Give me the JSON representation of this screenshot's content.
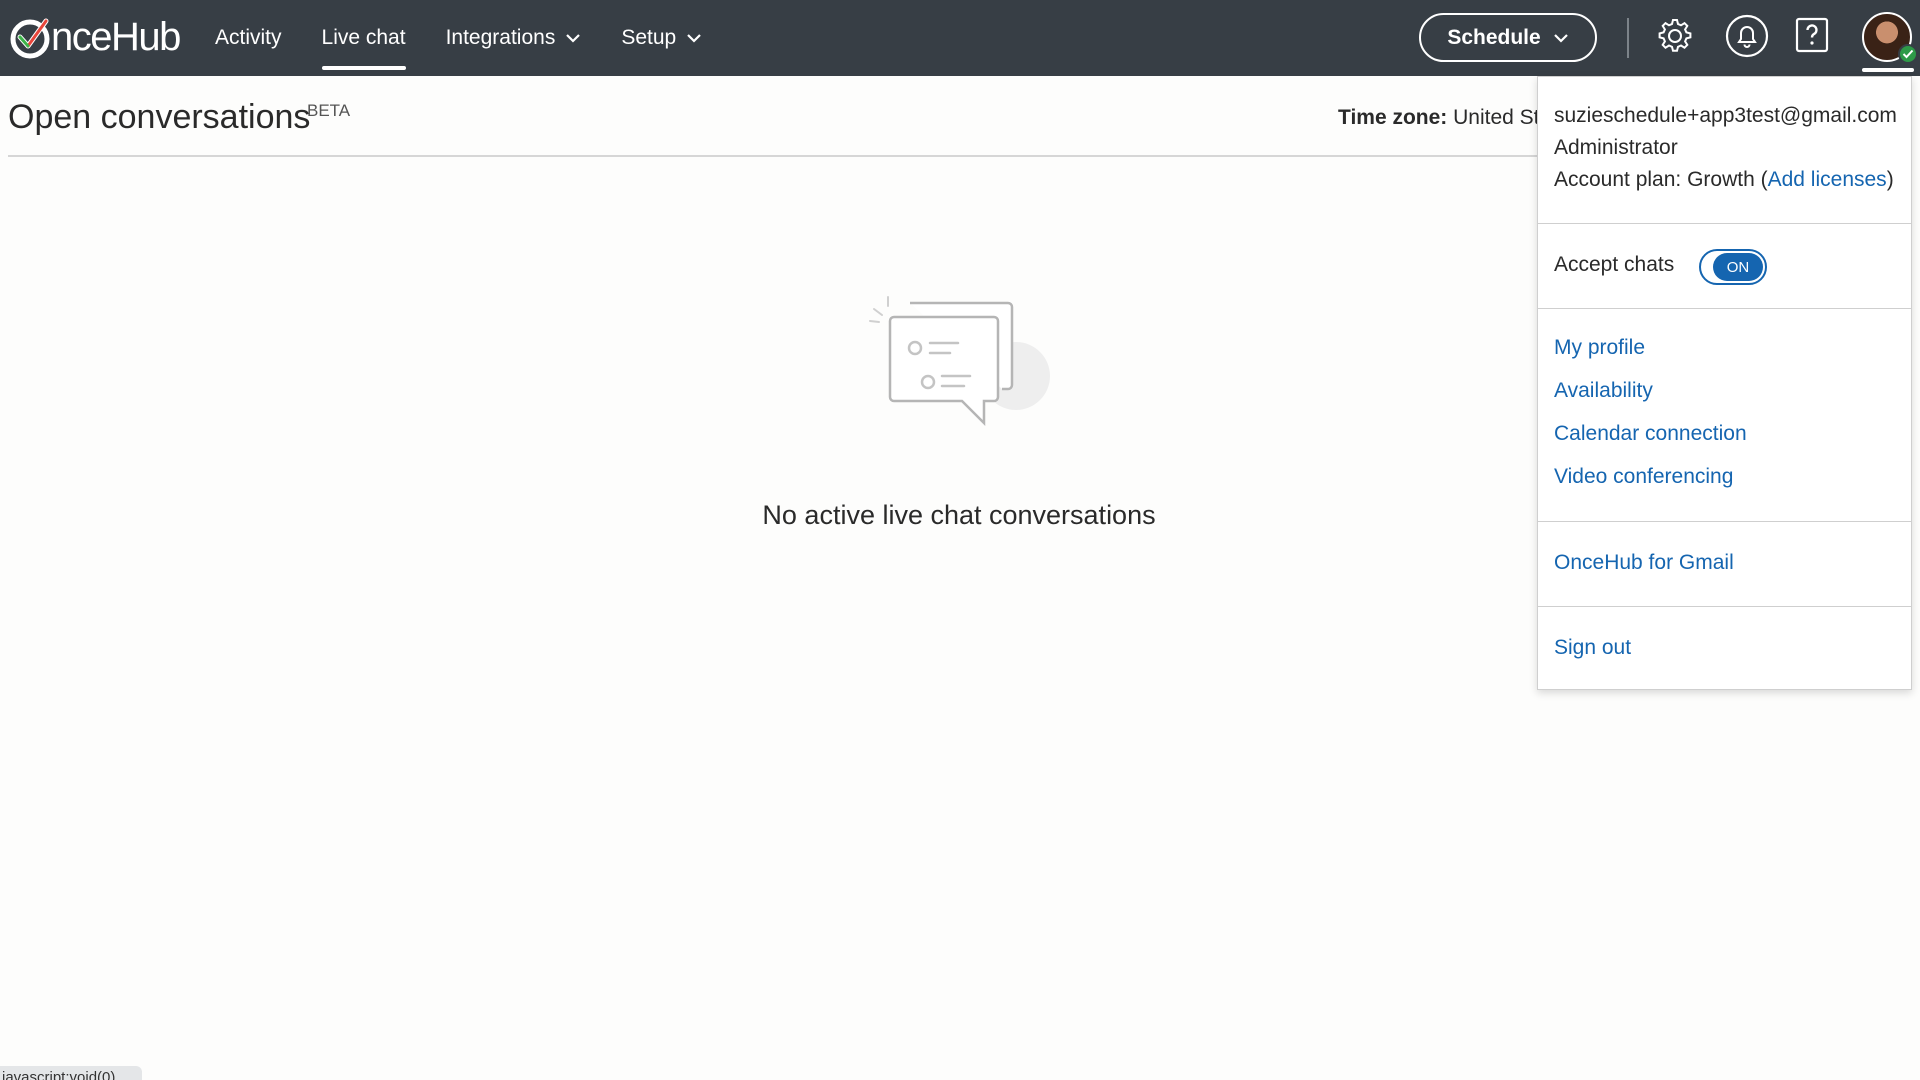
{
  "brand": {
    "logo_text": "nceHub",
    "accent": "#1565b0",
    "topbar_bg": "#373e45"
  },
  "nav": {
    "items": [
      {
        "label": "Activity",
        "active": false,
        "dropdown": false
      },
      {
        "label": "Live chat",
        "active": true,
        "dropdown": false
      },
      {
        "label": "Integrations",
        "active": false,
        "dropdown": true
      },
      {
        "label": "Setup",
        "active": false,
        "dropdown": true
      }
    ]
  },
  "toolbar": {
    "schedule_label": "Schedule",
    "icons": [
      "gear-icon",
      "bell-icon",
      "help-icon",
      "avatar"
    ]
  },
  "page": {
    "title": "Open conversations",
    "badge": "BETA",
    "timezone_label": "Time zone:",
    "timezone_value": "United St"
  },
  "empty_state": {
    "message": "No active live chat conversations",
    "icon": "chat-bubbles-illustration"
  },
  "account_menu": {
    "email": "suzieschedule+app3test@gmail.com",
    "role": "Administrator",
    "plan_prefix": "Account plan: Growth (",
    "plan_link": "Add licenses",
    "plan_suffix": ")",
    "accept_chats_label": "Accept chats",
    "accept_chats_state": "ON",
    "links": [
      "My profile",
      "Availability",
      "Calendar connection",
      "Video conferencing"
    ],
    "gmail_link": "OnceHub for Gmail",
    "sign_out": "Sign out"
  },
  "statusbar": {
    "text": "javascript:void(0)"
  }
}
